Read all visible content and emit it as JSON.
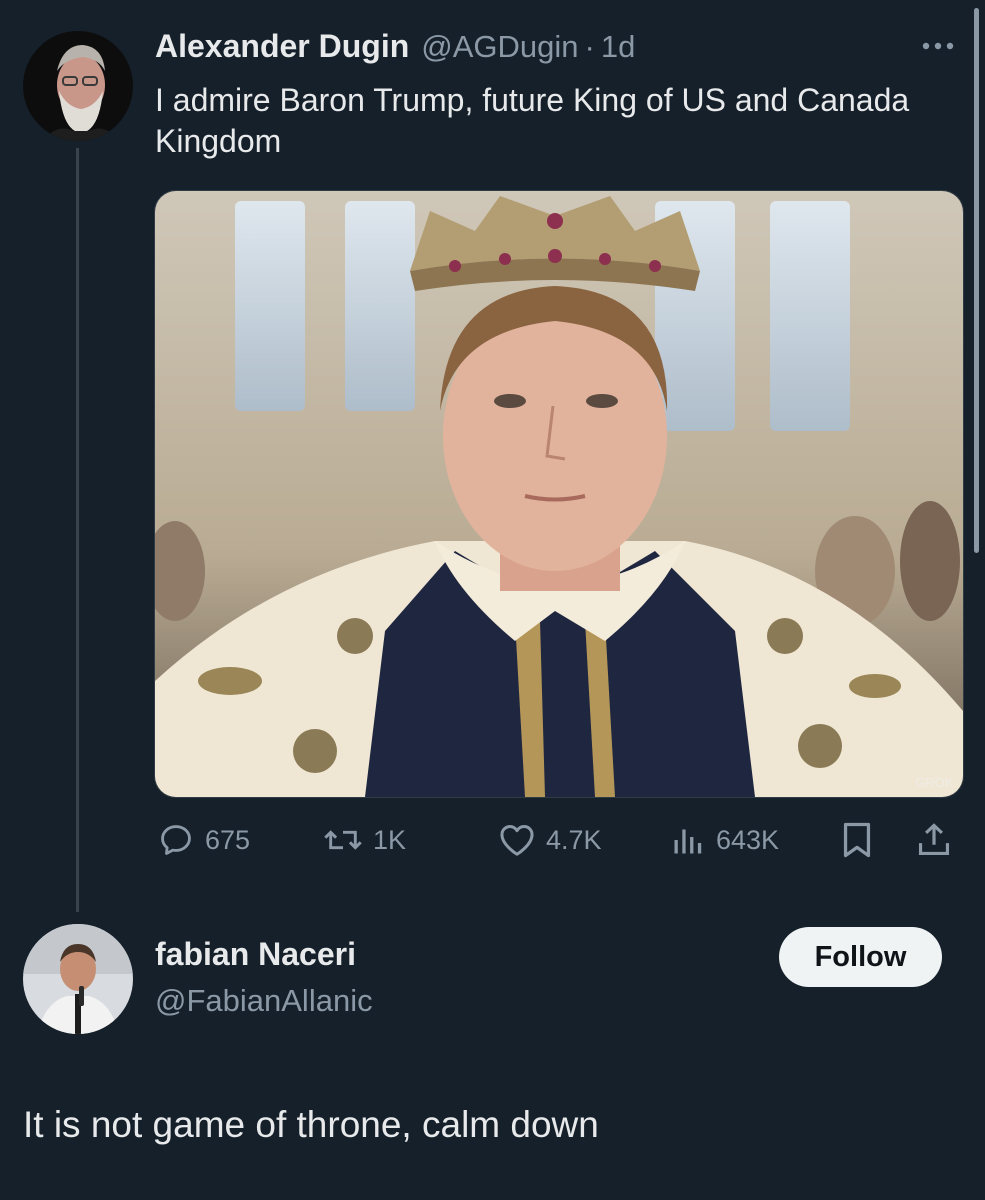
{
  "original_tweet": {
    "author": {
      "display_name": "Alexander Dugin",
      "handle": "@AGDugin",
      "avatar": "avatar-elderly-bearded-man"
    },
    "separator": "·",
    "time": "1d",
    "more_icon": "more-horizontal-icon",
    "text": "I admire Baron Trump, future King of US and Canada Kingdom",
    "media": {
      "type": "photo",
      "watermark": "GROK"
    },
    "actions": {
      "reply": {
        "icon": "reply-icon",
        "count": "675"
      },
      "retweet": {
        "icon": "retweet-icon",
        "count": "1K"
      },
      "like": {
        "icon": "heart-icon",
        "count": "4.7K"
      },
      "views": {
        "icon": "views-chart-icon",
        "count": "643K"
      },
      "bookmark": {
        "icon": "bookmark-icon"
      },
      "share": {
        "icon": "share-icon"
      }
    }
  },
  "reply": {
    "author": {
      "display_name": "fabian Naceri",
      "handle": "@FabianAllanic",
      "avatar": "avatar-man-with-microphone"
    },
    "follow_label": "Follow",
    "text": "It is not game of throne, calm down"
  },
  "colors": {
    "background": "#15202b",
    "primary_text": "#e7e9ea",
    "secondary_text": "#8b98a5",
    "thread_line": "#38444d",
    "follow_button_bg": "#eff3f4",
    "follow_button_text": "#0f1419"
  }
}
